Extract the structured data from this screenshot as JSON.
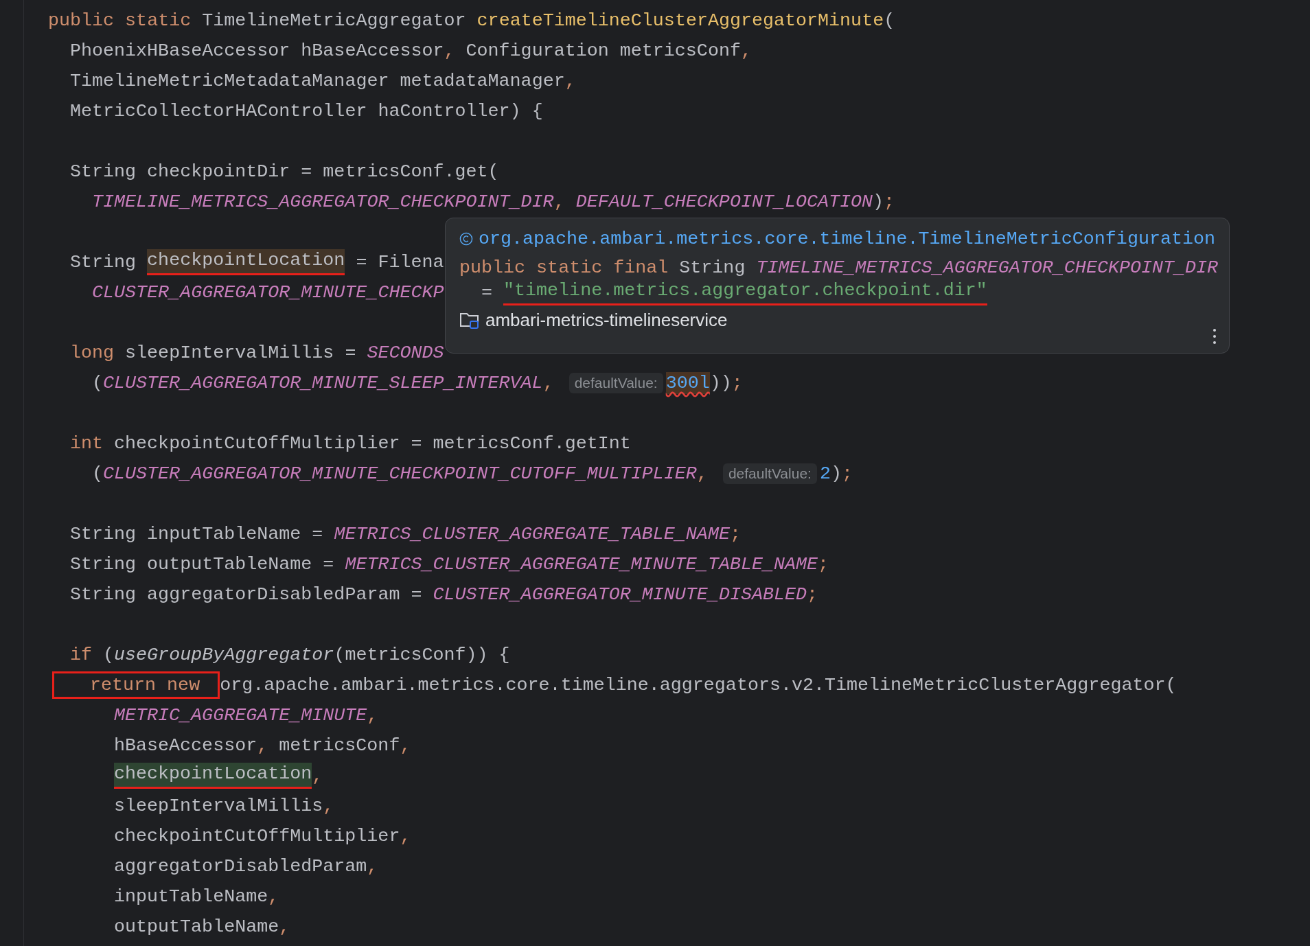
{
  "editor": {
    "lines": [
      {
        "kind": "code",
        "tokens": [
          {
            "kind": "kw",
            "text": "public static "
          },
          {
            "kind": "plain",
            "text": "TimelineMetricAggregator "
          },
          {
            "kind": "decl",
            "text": "createTimelineClusterAggregatorMinute"
          },
          {
            "kind": "plain",
            "text": "("
          }
        ],
        "children": [
          {
            "kind": "code",
            "tokens": [
              {
                "kind": "plain",
                "text": "PhoenixHBaseAccessor hBaseAccessor"
              },
              {
                "kind": "punct",
                "text": ", "
              },
              {
                "kind": "plain",
                "text": "Configuration metricsConf"
              },
              {
                "kind": "punct",
                "text": ","
              }
            ]
          },
          {
            "kind": "code",
            "tokens": [
              {
                "kind": "plain",
                "text": "TimelineMetricMetadataManager metadataManager"
              },
              {
                "kind": "punct",
                "text": ","
              }
            ]
          },
          {
            "kind": "code",
            "tokens": [
              {
                "kind": "plain",
                "text": "MetricCollectorHAController haController) {"
              }
            ]
          },
          {
            "kind": "blank"
          },
          {
            "kind": "code",
            "tokens": [
              {
                "kind": "plain",
                "text": "String checkpointDir = metricsConf.get("
              }
            ],
            "children": [
              {
                "kind": "code",
                "tokens": [
                  {
                    "kind": "const",
                    "text": "TIMELINE_METRICS_AGGREGATOR_CHECKPOINT_DIR"
                  },
                  {
                    "kind": "punct",
                    "text": ", "
                  },
                  {
                    "kind": "const",
                    "text": "DEFAULT_CHECKPOINT_LOCATION"
                  },
                  {
                    "kind": "plain",
                    "text": ")"
                  },
                  {
                    "kind": "punct",
                    "text": ";"
                  }
                ]
              }
            ]
          },
          {
            "kind": "blank"
          },
          {
            "kind": "code",
            "tokens": [
              {
                "kind": "plain",
                "text": "String "
              },
              {
                "kind": "plain",
                "text": "checkpointLocation",
                "write_highlight": true,
                "underlined": true
              },
              {
                "kind": "plain",
                "text": " = Filena"
              }
            ],
            "children": [
              {
                "kind": "code",
                "tokens": [
                  {
                    "kind": "const",
                    "text": "CLUSTER_AGGREGATOR_MINUTE_CHECKP"
                  }
                ]
              }
            ]
          },
          {
            "kind": "blank"
          },
          {
            "kind": "code",
            "tokens": [
              {
                "kind": "kw",
                "text": "long "
              },
              {
                "kind": "plain",
                "text": "sleepIntervalMillis = "
              },
              {
                "kind": "const",
                "text": "SECONDS"
              }
            ],
            "children": [
              {
                "kind": "code",
                "tokens": [
                  {
                    "kind": "plain",
                    "text": "("
                  },
                  {
                    "kind": "const",
                    "text": "CLUSTER_AGGREGATOR_MINUTE_SLEEP_INTERVAL"
                  },
                  {
                    "kind": "punct",
                    "text": ", "
                  },
                  {
                    "kind": "hint",
                    "text": "defaultValue:"
                  },
                  {
                    "kind": "num",
                    "text": "300l",
                    "warning": true
                  },
                  {
                    "kind": "plain",
                    "text": "))"
                  },
                  {
                    "kind": "punct",
                    "text": ";"
                  }
                ]
              }
            ]
          },
          {
            "kind": "blank"
          },
          {
            "kind": "code",
            "tokens": [
              {
                "kind": "kw",
                "text": "int "
              },
              {
                "kind": "plain",
                "text": "checkpointCutOffMultiplier = metricsConf.getInt"
              }
            ],
            "children": [
              {
                "kind": "code",
                "tokens": [
                  {
                    "kind": "plain",
                    "text": "("
                  },
                  {
                    "kind": "const",
                    "text": "CLUSTER_AGGREGATOR_MINUTE_CHECKPOINT_CUTOFF_MULTIPLIER"
                  },
                  {
                    "kind": "punct",
                    "text": ", "
                  },
                  {
                    "kind": "hint",
                    "text": "defaultValue:"
                  },
                  {
                    "kind": "num",
                    "text": "2"
                  },
                  {
                    "kind": "plain",
                    "text": ")"
                  },
                  {
                    "kind": "punct",
                    "text": ";"
                  }
                ]
              }
            ]
          },
          {
            "kind": "blank"
          },
          {
            "kind": "code",
            "tokens": [
              {
                "kind": "plain",
                "text": "String inputTableName = "
              },
              {
                "kind": "const",
                "text": "METRICS_CLUSTER_AGGREGATE_TABLE_NAME"
              },
              {
                "kind": "punct",
                "text": ";"
              }
            ]
          },
          {
            "kind": "code",
            "tokens": [
              {
                "kind": "plain",
                "text": "String outputTableName = "
              },
              {
                "kind": "const",
                "text": "METRICS_CLUSTER_AGGREGATE_MINUTE_TABLE_NAME"
              },
              {
                "kind": "punct",
                "text": ";"
              }
            ]
          },
          {
            "kind": "code",
            "tokens": [
              {
                "kind": "plain",
                "text": "String aggregatorDisabledParam = "
              },
              {
                "kind": "const",
                "text": "CLUSTER_AGGREGATOR_MINUTE_DISABLED"
              },
              {
                "kind": "punct",
                "text": ";"
              }
            ]
          },
          {
            "kind": "blank"
          },
          {
            "kind": "code",
            "tokens": [
              {
                "kind": "kw",
                "text": "if "
              },
              {
                "kind": "plain",
                "text": "("
              },
              {
                "kind": "call",
                "text": "useGroupByAggregator"
              },
              {
                "kind": "plain",
                "text": "(metricsConf)) {"
              }
            ],
            "children": [
              {
                "kind": "code",
                "tokens": [
                  {
                    "kind": "kw",
                    "text": "return new",
                    "boxed": true
                  },
                  {
                    "kind": "plain",
                    "text": " org.apache.ambari.metrics.core.timeline.aggregators.v2.TimelineMetricClusterAggregator("
                  }
                ],
                "children": [
                  {
                    "kind": "code",
                    "tokens": [
                      {
                        "kind": "const",
                        "text": "METRIC_AGGREGATE_MINUTE"
                      },
                      {
                        "kind": "punct",
                        "text": ","
                      }
                    ]
                  },
                  {
                    "kind": "code",
                    "tokens": [
                      {
                        "kind": "plain",
                        "text": "hBaseAccessor"
                      },
                      {
                        "kind": "punct",
                        "text": ", "
                      },
                      {
                        "kind": "plain",
                        "text": "metricsConf"
                      },
                      {
                        "kind": "punct",
                        "text": ","
                      }
                    ]
                  },
                  {
                    "kind": "code",
                    "tokens": [
                      {
                        "kind": "plain",
                        "text": "checkpointLocation",
                        "read_highlight": true,
                        "underlined": true
                      },
                      {
                        "kind": "punct",
                        "text": ","
                      }
                    ]
                  },
                  {
                    "kind": "code",
                    "tokens": [
                      {
                        "kind": "plain",
                        "text": "sleepIntervalMillis"
                      },
                      {
                        "kind": "punct",
                        "text": ","
                      }
                    ]
                  },
                  {
                    "kind": "code",
                    "tokens": [
                      {
                        "kind": "plain",
                        "text": "checkpointCutOffMultiplier"
                      },
                      {
                        "kind": "punct",
                        "text": ","
                      }
                    ]
                  },
                  {
                    "kind": "code",
                    "tokens": [
                      {
                        "kind": "plain",
                        "text": "aggregatorDisabledParam"
                      },
                      {
                        "kind": "punct",
                        "text": ","
                      }
                    ]
                  },
                  {
                    "kind": "code",
                    "tokens": [
                      {
                        "kind": "plain",
                        "text": "inputTableName"
                      },
                      {
                        "kind": "punct",
                        "text": ","
                      }
                    ]
                  },
                  {
                    "kind": "code",
                    "tokens": [
                      {
                        "kind": "plain",
                        "text": "outputTableName"
                      },
                      {
                        "kind": "punct",
                        "text": ","
                      }
                    ]
                  }
                ]
              }
            ]
          }
        ]
      }
    ]
  },
  "popup": {
    "header": "org.apache.ambari.metrics.core.timeline.TimelineMetricConfiguration",
    "lines": [
      {
        "kind": "code",
        "tokens": [
          {
            "kind": "kw",
            "text": "public static final "
          },
          {
            "kind": "plain",
            "text": "String "
          },
          {
            "kind": "const",
            "text": "TIMELINE_METRICS_AGGREGATOR_CHECKPOINT_DIR"
          }
        ],
        "children": [
          {
            "kind": "code",
            "tokens": [
              {
                "kind": "plain",
                "text": "= "
              },
              {
                "kind": "str",
                "text": "\"timeline.metrics.aggregator.checkpoint.dir\"",
                "underlined": true
              }
            ]
          }
        ]
      }
    ],
    "module": "ambari-metrics-timelineservice"
  }
}
